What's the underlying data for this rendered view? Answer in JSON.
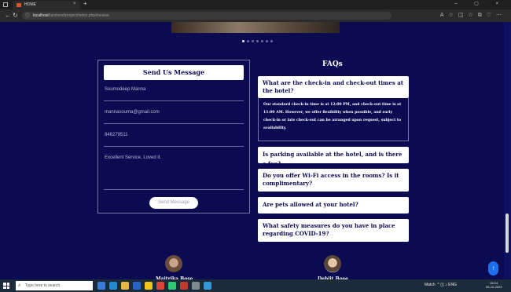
{
  "browser": {
    "tab_title": "HOME",
    "tab_close": "×",
    "new_tab": "+",
    "url_host": "localhost",
    "url_path": "/landvest/project/index.php#review",
    "window_controls": "–  ▢  ×"
  },
  "carousel": {
    "dots": 7,
    "active_index": 0
  },
  "form": {
    "title": "Send Us Message",
    "name_value": "Soumodeep Manna",
    "email_value": "mannasouma@gmail.com",
    "phone_value": "846279511",
    "message_value": "Excellent Service, Loved it.",
    "submit_label": "Send Message"
  },
  "faq": {
    "title": "FAQs",
    "items": [
      {
        "question": "What are the check-in and check-out times at the hotel?",
        "answer": "Our standard check-in time is at 12:00 PM, and check-out time is at 11:00 AM. However, we offer flexibility when possible, and early check-in or late check-out can be arranged upon request, subject to availability."
      },
      {
        "question": "Is parking available at the hotel, and is there a fee?"
      },
      {
        "question": "Do you offer Wi-Fi access in the rooms? Is it complimentary?"
      },
      {
        "question": "Are pets allowed at your hotel?"
      },
      {
        "question": "What safety measures do you have in place regarding COVID-19?"
      }
    ]
  },
  "team": {
    "members": [
      {
        "name": "Maitrika Bose"
      },
      {
        "name": "Debjit Bose"
      }
    ]
  },
  "back_to_top_icon": "↑",
  "taskbar": {
    "search_placeholder": "Type here to search",
    "weather": "Match",
    "lang": "ENG",
    "time": "08:24",
    "date": "06-10-2023"
  }
}
